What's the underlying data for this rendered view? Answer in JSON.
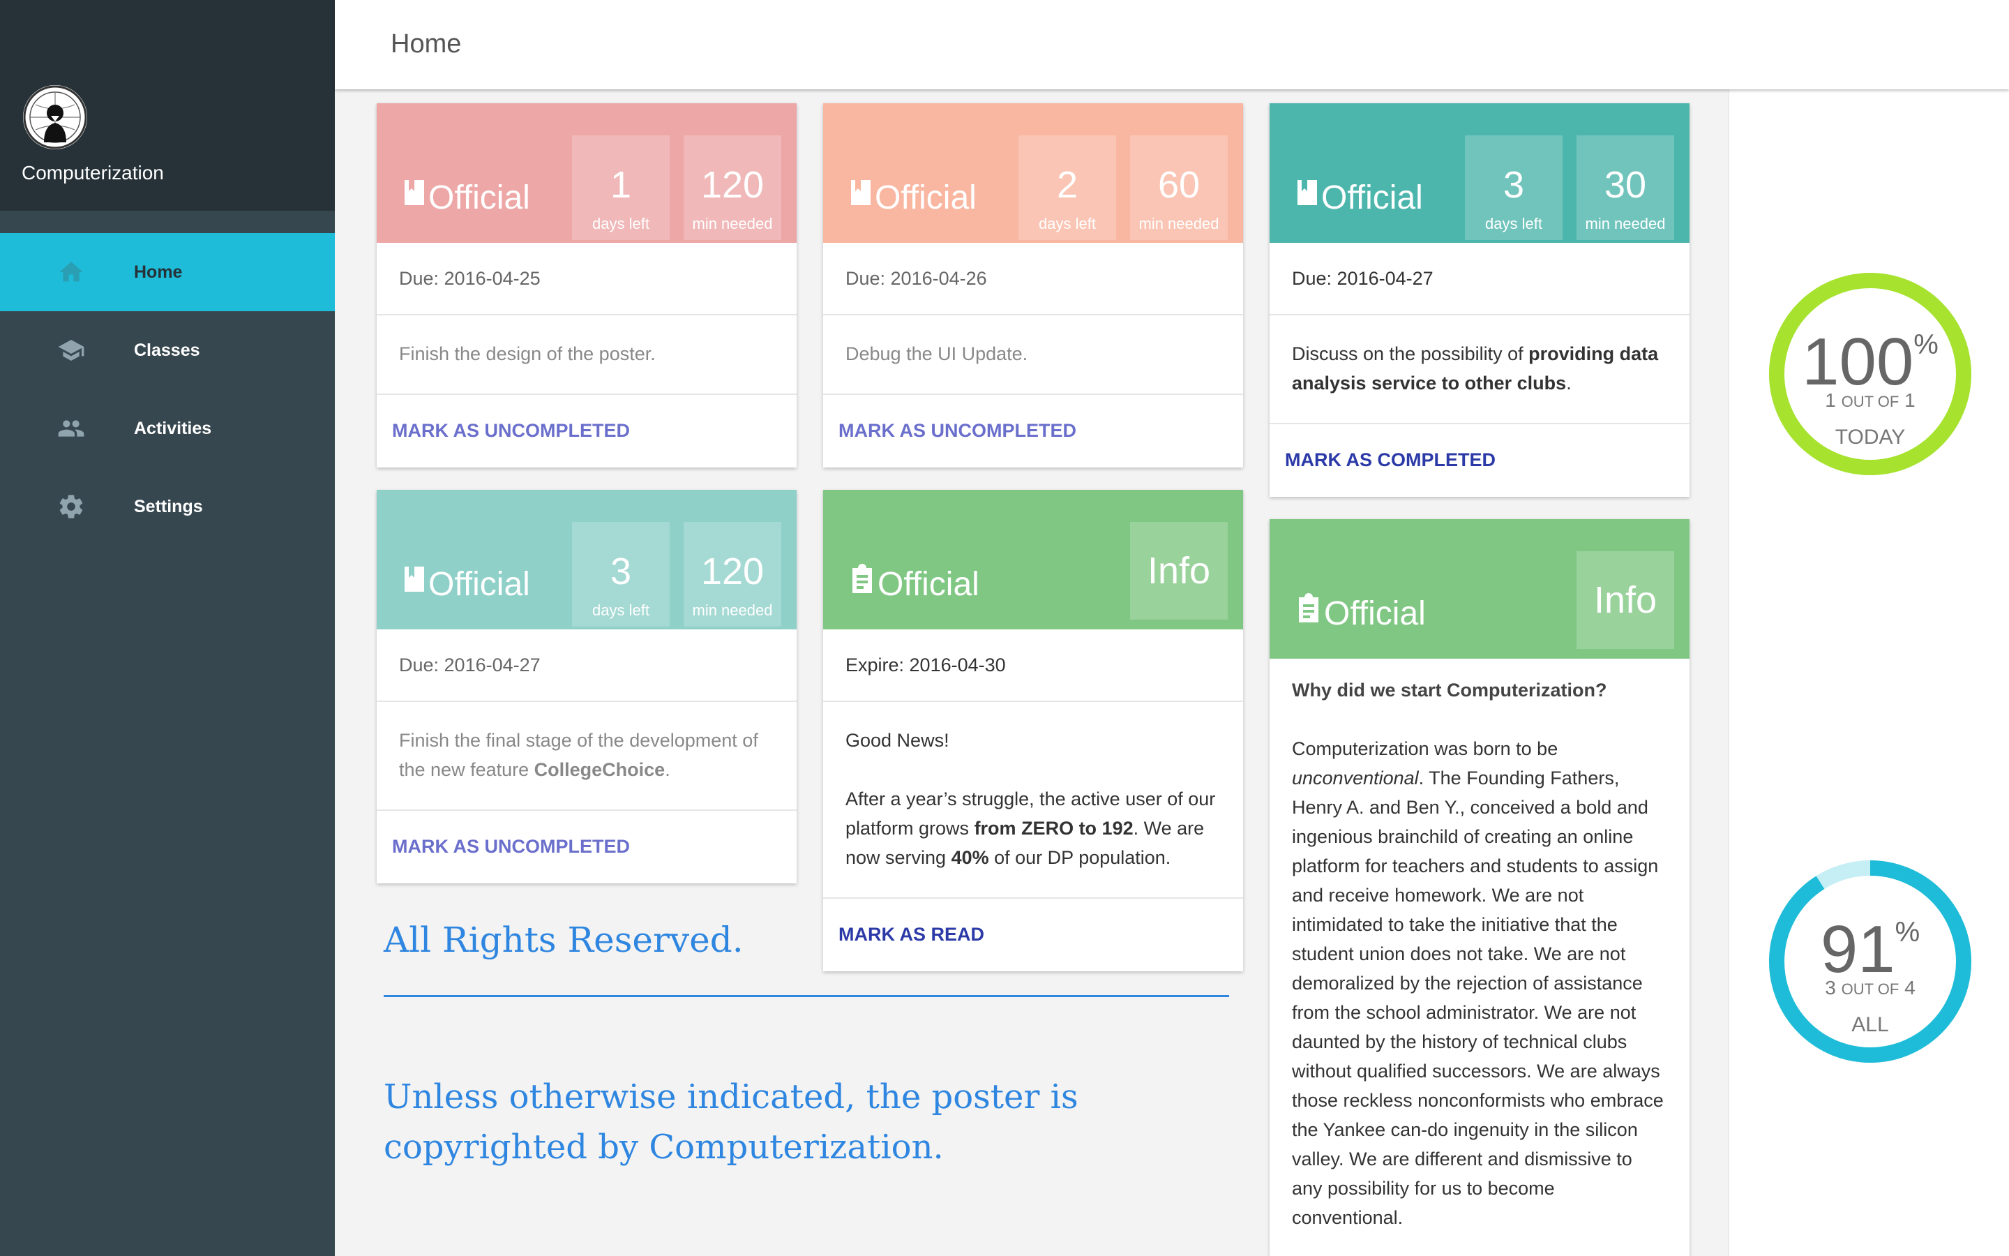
{
  "app": {
    "name": "Computerization"
  },
  "sidebar": {
    "items": [
      {
        "label": "Home",
        "icon": "home-icon",
        "active": true
      },
      {
        "label": "Classes",
        "icon": "school-icon",
        "active": false
      },
      {
        "label": "Activities",
        "icon": "people-icon",
        "active": false
      },
      {
        "label": "Settings",
        "icon": "gear-icon",
        "active": false
      }
    ]
  },
  "header": {
    "title": "Home"
  },
  "stats": {
    "today": {
      "percent": "100",
      "symbol": "%",
      "done": "1",
      "out_of": "OUT OF",
      "total": "1",
      "label": "TODAY",
      "fraction": 1.0,
      "color": "#a6e22e"
    },
    "all": {
      "percent": "91",
      "symbol": "%",
      "done": "3",
      "out_of": "OUT OF",
      "total": "4",
      "label": "ALL",
      "fraction": 0.91,
      "color": "#1ebcd8"
    }
  },
  "cards": [
    {
      "type": "Official",
      "color": "#eda7a7",
      "days": "1",
      "days_caption": "days left",
      "minutes": "120",
      "minutes_caption": "min needed",
      "due": "Due: 2016-04-25",
      "desc": "Finish the design of the poster.",
      "action": "MARK AS UNCOMPLETED"
    },
    {
      "type": "Official",
      "color": "#f9b7a2",
      "days": "2",
      "days_caption": "days left",
      "minutes": "60",
      "minutes_caption": "min needed",
      "due": "Due: 2016-04-26",
      "desc": "Debug the UI Update.",
      "action": "MARK AS UNCOMPLETED"
    },
    {
      "type": "Official",
      "color": "#4db6ac",
      "days": "3",
      "days_caption": "days left",
      "minutes": "30",
      "minutes_caption": "min needed",
      "due": "Due: 2016-04-27",
      "desc_a": "Discuss on the possibility of ",
      "desc_b": "providing data analysis service to other clubs",
      "desc_c": ".",
      "action": "MARK AS COMPLETED"
    },
    {
      "type": "Official",
      "color": "#8fd0c9",
      "days": "3",
      "days_caption": "days left",
      "minutes": "120",
      "minutes_caption": "min needed",
      "due": "Due: 2016-04-27",
      "desc_a": "Finish the final stage of the development of the new feature ",
      "desc_b": "CollegeChoice",
      "desc_c": ".",
      "action": "MARK AS UNCOMPLETED"
    },
    {
      "type": "Official",
      "color": "#81c784",
      "badge": "Info",
      "due": "Expire: 2016-04-30",
      "p1": "Good News!",
      "p2_a": "After a year’s struggle, the active user of our platform grows ",
      "p2_b": "from ZERO to 192",
      "p2_c": ". We are now serving ",
      "p2_d": "40%",
      "p2_e": " of our DP population.",
      "action": "MARK AS READ"
    },
    {
      "type": "Official",
      "color": "#81c784",
      "badge": "Info",
      "question": "Why did we start Computerization?",
      "b_a": "Computerization was born to be ",
      "b_em": "unconventional",
      "b_rest": ". The Founding Fathers, Henry A. and Ben Y., conceived a bold and ingenious brainchild of creating an online platform for teachers and students to assign and receive homework. We are not intimidated to take the initiative that the student union does not take. We are not demoralized by the rejection of assistance from the school administrator. We are not daunted by the history of technical clubs without qualified successors. We are always those reckless nonconformists who embrace the Yankee can-do ingenuity in the silicon valley. We are different and dismissive to any possibility for us to become conventional."
    }
  ],
  "footer": {
    "rights": "All Rights Reserved.",
    "copyright": "Unless otherwise indicated, the poster is copyrighted by Computerization."
  }
}
